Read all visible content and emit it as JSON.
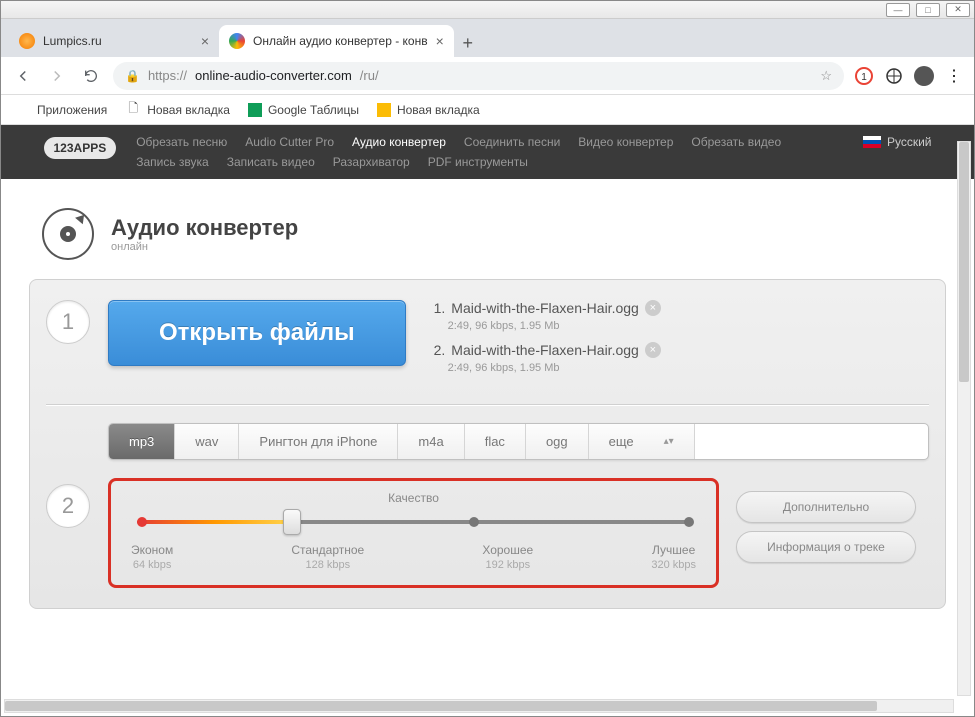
{
  "tabs": [
    {
      "title": "Lumpics.ru",
      "active": false
    },
    {
      "title": "Онлайн аудио конвертер - конв",
      "active": true
    }
  ],
  "address": {
    "url_prefix": "https://",
    "url_host": "online-audio-converter.com",
    "url_path": "/ru/"
  },
  "bookmarks": [
    {
      "label": "Приложения"
    },
    {
      "label": "Новая вкладка"
    },
    {
      "label": "Google Таблицы"
    },
    {
      "label": "Новая вкладка"
    }
  ],
  "apps_header": {
    "logo": "123APPS",
    "links": [
      "Обрезать песню",
      "Audio Cutter Pro",
      "Аудио конвертер",
      "Соединить песни",
      "Видео конвертер",
      "Обрезать видео",
      "Запись звука",
      "Записать видео",
      "Разархиватор",
      "PDF инструменты"
    ],
    "active_link": "Аудио конвертер",
    "language": "Русский"
  },
  "page": {
    "title": "Аудио конвертер",
    "subtitle": "онлайн"
  },
  "step1": {
    "open_button": "Открыть файлы",
    "files": [
      {
        "idx": "1.",
        "name": "Maid-with-the-Flaxen-Hair.ogg",
        "meta": "2:49, 96 kbps, 1.95 Mb"
      },
      {
        "idx": "2.",
        "name": "Maid-with-the-Flaxen-Hair.ogg",
        "meta": "2:49, 96 kbps, 1.95 Mb"
      }
    ]
  },
  "step2": {
    "formats": [
      "mp3",
      "wav",
      "Рингтон для iPhone",
      "m4a",
      "flac",
      "ogg",
      "еще"
    ],
    "active_format": "mp3",
    "quality_title": "Качество",
    "quality_levels": [
      {
        "label": "Эконом",
        "kbps": "64 kbps"
      },
      {
        "label": "Стандартное",
        "kbps": "128 kbps"
      },
      {
        "label": "Хорошее",
        "kbps": "192 kbps"
      },
      {
        "label": "Лучшее",
        "kbps": "320 kbps"
      }
    ],
    "advanced_btn": "Дополнительно",
    "track_info_btn": "Информация о треке"
  }
}
